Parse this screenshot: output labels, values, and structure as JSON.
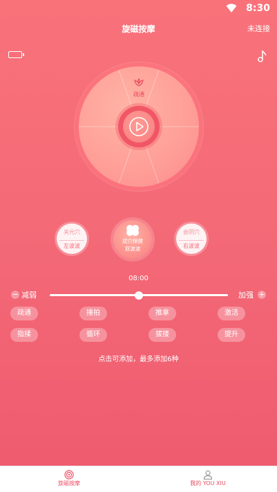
{
  "status": {
    "time": "8:30"
  },
  "header": {
    "title": "旋磁按摩",
    "connection": "未连接"
  },
  "dial": {
    "top_segment_label": "疏通"
  },
  "modes": {
    "left": {
      "line1": "关元穴",
      "line2": "左波波"
    },
    "center": {
      "line1": "双穴保健",
      "line2": "双波波"
    },
    "right": {
      "line1": "会阴穴",
      "line2": "右波波"
    }
  },
  "timer": "08:00",
  "intensity": {
    "decrease_label": "减弱",
    "increase_label": "加强",
    "level_percent": 50
  },
  "techniques": [
    "疏通",
    "捶拍",
    "推拿",
    "激活",
    "指揉",
    "循环",
    "拔搂",
    "提升"
  ],
  "hint": "点击可添加，最多添加6种",
  "tabbar": {
    "tab1": "旋磁按摩",
    "tab2": "我的 YOU XIU"
  },
  "colors": {
    "background": "#f46a77",
    "accent": "#ef4c64",
    "dial": "#ffa098"
  }
}
